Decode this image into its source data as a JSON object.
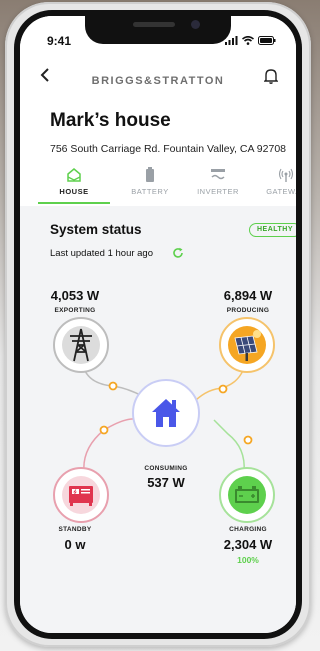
{
  "status_bar": {
    "time": "9:41"
  },
  "header": {
    "brand": "BRIGGS&STRATTON"
  },
  "house": {
    "title": "Mark’s house",
    "address": "756 South Carriage Rd. Fountain Valley, CA 92708"
  },
  "tabs": [
    {
      "label": "HOUSE",
      "icon": "house-icon",
      "active": true
    },
    {
      "label": "BATTERY",
      "icon": "battery-icon",
      "active": false
    },
    {
      "label": "INVERTER",
      "icon": "inverter-icon",
      "active": false
    },
    {
      "label": "GATEWAY",
      "icon": "gateway-icon",
      "active": false
    }
  ],
  "system": {
    "title": "System status",
    "badge": "HEALTHY",
    "updated": "Last updated 1 hour ago"
  },
  "grid": {
    "value": "4,053 W",
    "label": "EXPORTING"
  },
  "solar": {
    "value": "6,894 W",
    "label": "PRODUCING"
  },
  "home": {
    "value": "537 W",
    "label": "CONSUMING"
  },
  "generator": {
    "value": "0 w",
    "label": "STANDBY"
  },
  "battery": {
    "value": "2,304 W",
    "label": "CHARGING",
    "percent": "100%"
  },
  "colors": {
    "accent_green": "#5ed04d",
    "home_blue": "#4a57e8",
    "solar_orange": "#f5a623",
    "generator_red": "#e0344e",
    "grid_gray": "#9a9a9a"
  }
}
